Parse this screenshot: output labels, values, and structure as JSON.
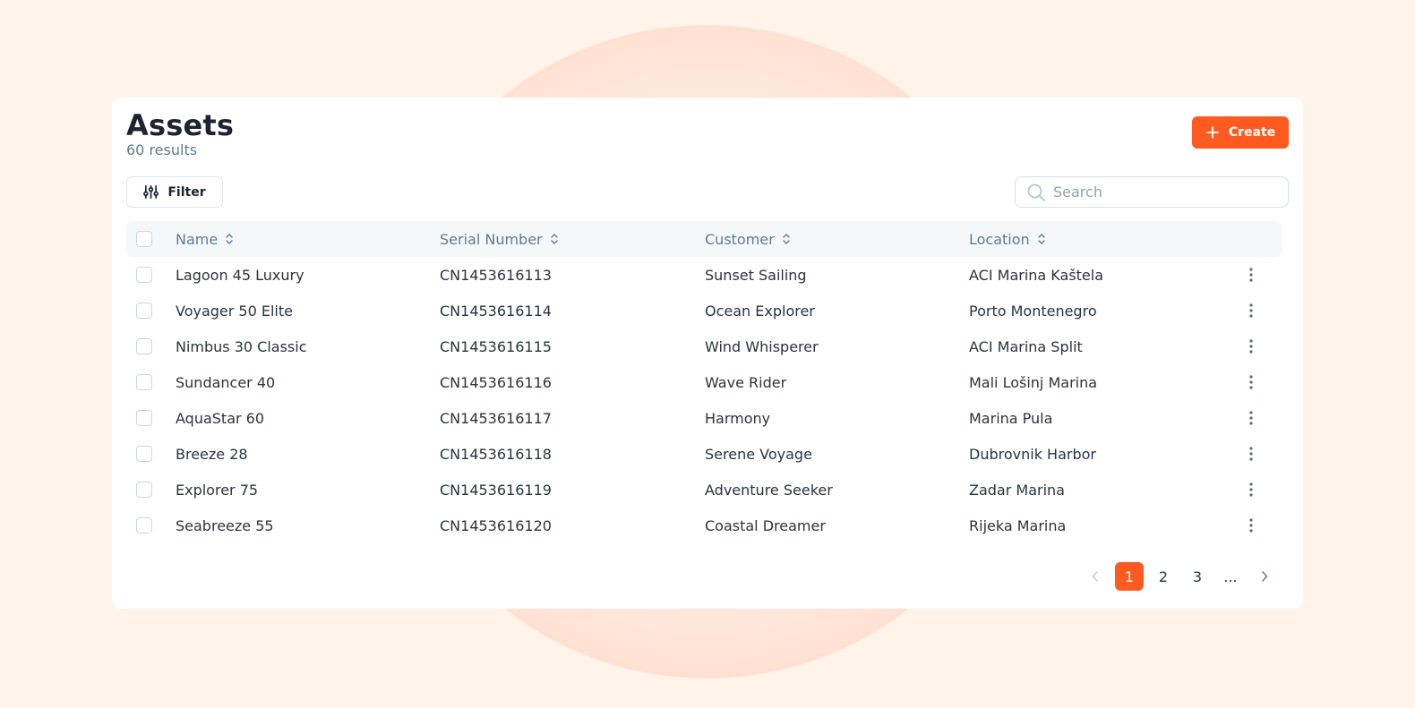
{
  "page": {
    "title": "Assets",
    "results": "60 results"
  },
  "toolbar": {
    "create_label": "Create",
    "filter_label": "Filter",
    "search_placeholder": "Search"
  },
  "table": {
    "columns": [
      "Name",
      "Serial Number",
      "Customer",
      "Location"
    ],
    "rows": [
      {
        "name": "Lagoon 45 Luxury",
        "serial": "CN1453616113",
        "customer": "Sunset Sailing",
        "location": "ACI Marina Kaštela"
      },
      {
        "name": "Voyager 50 Elite",
        "serial": "CN1453616114",
        "customer": "Ocean Explorer",
        "location": "Porto Montenegro"
      },
      {
        "name": "Nimbus 30 Classic",
        "serial": "CN1453616115",
        "customer": "Wind Whisperer",
        "location": "ACI Marina Split"
      },
      {
        "name": "Sundancer 40",
        "serial": "CN1453616116",
        "customer": "Wave Rider",
        "location": "Mali Lošinj Marina"
      },
      {
        "name": "AquaStar 60",
        "serial": "CN1453616117",
        "customer": "Harmony",
        "location": "Marina Pula"
      },
      {
        "name": "Breeze 28",
        "serial": "CN1453616118",
        "customer": "Serene Voyage",
        "location": "Dubrovnik Harbor"
      },
      {
        "name": "Explorer 75",
        "serial": "CN1453616119",
        "customer": "Adventure Seeker",
        "location": "Zadar Marina"
      },
      {
        "name": "Seabreeze 55",
        "serial": "CN1453616120",
        "customer": "Coastal Dreamer",
        "location": "Rijeka Marina"
      }
    ]
  },
  "pagination": {
    "pages": [
      "1",
      "2",
      "3",
      "..."
    ],
    "current": "1"
  },
  "icons": {
    "create": "plus-icon",
    "filter": "sliders-icon",
    "search": "search-icon",
    "sort": "sort-icon",
    "row_menu": "more-vertical-icon",
    "prev": "chevron-left-icon",
    "next": "chevron-right-icon"
  },
  "colors": {
    "accent": "#ff5a1f",
    "background": "#fff3ea",
    "muted_text": "#5f7a92",
    "header_bg": "#f5f8f9"
  }
}
